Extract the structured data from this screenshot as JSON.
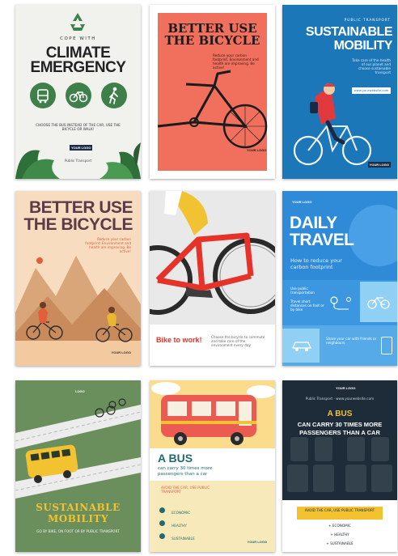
{
  "posters": {
    "p1": {
      "kicker": "COPE WITH",
      "title_line1": "CLIMATE",
      "title_line2": "EMERGENCY",
      "body": "CHOOSE THE BUS INSTEAD OF THE CAR, USE THE BICYCLE OR WALK!",
      "logo": "YOUR LOGO",
      "footer": "Public Transport",
      "bg": "#f1f1ee",
      "accent": "#3f7f4a",
      "icons": [
        "recycle-icon",
        "bus-icon",
        "bicycle-icon",
        "walking-icon"
      ]
    },
    "p2": {
      "title_line1": "BETTER USE",
      "title_line2": "THE BICYCLE",
      "body": "Reduce your carbon footprint. Environment and health are improving. Be active!",
      "logo": "YOUR LOGO",
      "bg": "#f06f5d",
      "accent": "#1b1b1b"
    },
    "p3": {
      "kicker": "PUBLIC TRANSPORT",
      "title_line1": "SUSTAINABLE",
      "title_line2": "MOBILITY",
      "body": "Take care of the health of our planet and choose sustainable transport",
      "button": "www.yourwebsite.com",
      "logo": "YOUR LOGO",
      "bg": "#1c77b8"
    },
    "p4": {
      "title_line1": "BETTER USE",
      "title_line2": "THE BICYCLE",
      "body": "Reduce your carbon footprint. Environment and health are improving. Be active!",
      "logo": "YOUR LOGO",
      "bg": "#f7dcc0",
      "accent": "#e35f3a"
    },
    "p5": {
      "title": "Bike to work!",
      "body": "Choose the bicycle to commute and take care of the environment every day.",
      "bg": "#ececec",
      "accent": "#e5332a"
    },
    "p6": {
      "logo": "YOUR LOGO",
      "title_line1": "DAILY",
      "title_line2": "TRAVEL",
      "subtitle": "How to reduce your carbon footprint",
      "body1": "Use public transportation",
      "body2": "Travel short distances on foot or by bike",
      "body3": "Share your car with friends or neighbours",
      "bg": "#2f8bd8"
    },
    "p7": {
      "title_line1": "SUSTAINABLE",
      "title_line2": "MOBILITY",
      "body": "GO BY BIKE, ON FOOT OR BY PUBLIC TRANSPORT",
      "logo": "LOGO",
      "bg": "#6b8f5c",
      "accent": "#f2c230"
    },
    "p8": {
      "title": "A BUS",
      "subtitle": "can carry 30 times more passengers than a car",
      "tagline": "AVOID THE CAR, USE PUBLIC TRANSPORT",
      "items": [
        "ECONOMIC",
        "HEALTHY",
        "SUSTAINABLE"
      ],
      "logo": "YOUR LOGO",
      "bg": "#fbdc8c",
      "accent": "#eb5b52"
    },
    "p9": {
      "logo": "YOUR LOGO",
      "header": "Public Transport · www.yourwebsite.com",
      "title": "A BUS",
      "subtitle_line1": "CAN CARRY 30 TIMES MORE",
      "subtitle_line2": "PASSENGERS THAN A CAR",
      "tagline": "AVOID THE CAR, USE PUBLIC TRANSPORT",
      "items": [
        "+ ECONOMIC",
        "+ HEALTHY",
        "+ SUSTAINABLE"
      ],
      "bg": "#1a2a36",
      "accent": "#f2c230"
    }
  }
}
